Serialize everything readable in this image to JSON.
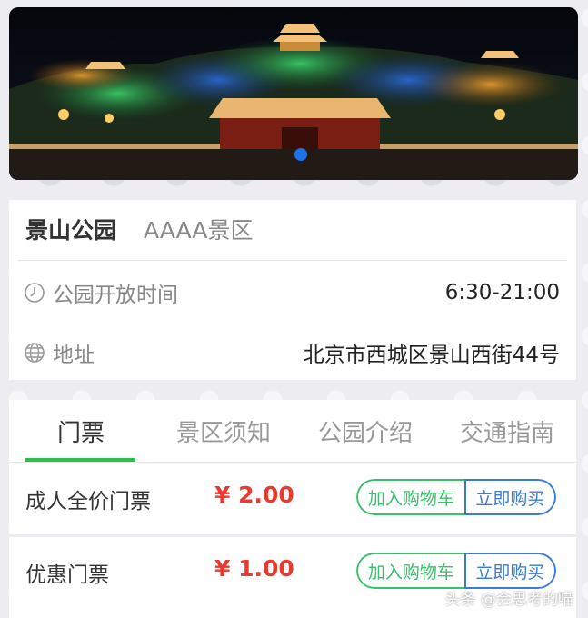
{
  "park": {
    "name": "景山公园",
    "level": "AAAA景区",
    "hours_label": "公园开放时间",
    "hours_value": "6:30-21:00",
    "address_label": "地址",
    "address_value": "北京市西城区景山西街44号"
  },
  "tabs": [
    {
      "label": "门票",
      "active": true
    },
    {
      "label": "景区须知",
      "active": false
    },
    {
      "label": "公园介绍",
      "active": false
    },
    {
      "label": "交通指南",
      "active": false
    }
  ],
  "tickets": [
    {
      "name": "成人全价门票",
      "price": "¥ 2.00",
      "cart_label": "加入购物车",
      "buy_label": "立即购买"
    },
    {
      "name": "优惠门票",
      "price": "¥ 1.00",
      "cart_label": "加入购物车",
      "buy_label": "立即购买"
    }
  ],
  "watermark": "头条 @会思考的喵",
  "colors": {
    "accent_green": "#2ebd4f",
    "price_red": "#e83a31",
    "buy_blue": "#3a7bd5",
    "carousel_dot": "#1e73e8"
  },
  "icons": {
    "hours": "clock-icon",
    "address": "globe-icon"
  }
}
